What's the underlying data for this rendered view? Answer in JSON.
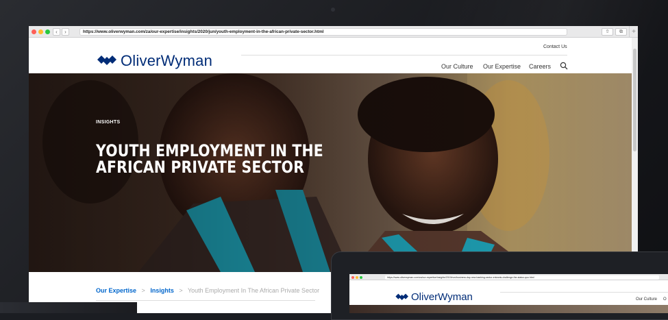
{
  "browser": {
    "url": "https://www.oliverwyman.com/za/our-expertise/insights/2020/jun/youth-employment-in-the-african-private-sector.html",
    "back_label": "‹",
    "forward_label": "›",
    "share_label": "⇧",
    "tabs_label": "⧉",
    "new_tab_label": "+"
  },
  "header": {
    "logo_text": "OliverWyman",
    "contact_label": "Contact Us",
    "nav": [
      {
        "label": "Our Culture"
      },
      {
        "label": "Our Expertise"
      },
      {
        "label": "Careers"
      }
    ],
    "search_icon": "search-icon"
  },
  "hero": {
    "eyebrow": "INSIGHTS",
    "title": "YOUTH EMPLOYMENT IN THE AFRICAN PRIVATE SECTOR"
  },
  "breadcrumb": {
    "items": [
      {
        "label": "Our Expertise"
      },
      {
        "label": "Insights"
      },
      {
        "label": "Youth Employment In The African Private Sector"
      }
    ],
    "separator": ">"
  },
  "second_device": {
    "url": "https://www.oliverwyman.com/za/our-expertise/insights/2019/nov/business-day-new-banking-sector-entrants-challenge-the-status-quo.html",
    "logo_text": "OliverWyman",
    "nav_label": "Our Culture",
    "nav_partial": "O"
  },
  "colors": {
    "brand": "#002c77",
    "link": "#0066cc",
    "traffic_red": "#fe5f57",
    "traffic_yellow": "#febc2e",
    "traffic_green": "#28c840"
  }
}
